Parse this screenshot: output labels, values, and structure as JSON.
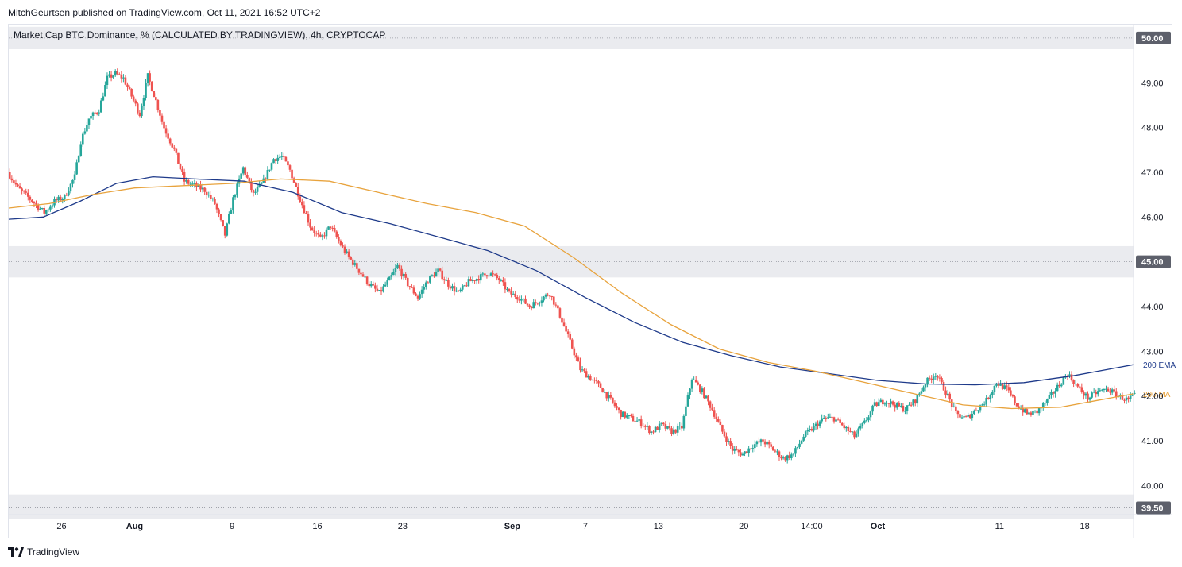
{
  "header": {
    "publisher": "MitchGeurtsen published on TradingView.com, Oct 11, 2021 16:52 UTC+2",
    "symbol_title": "Market Cap BTC Dominance, % (CALCULATED BY TRADINGVIEW), 4h, CRYPTOCAP"
  },
  "footer": {
    "brand": "TradingView",
    "logo_icon": "tradingview-logo-icon"
  },
  "colors": {
    "up": "#26a69a",
    "down": "#ef5350",
    "ema": "#1e3a8a",
    "ma": "#e8a33d",
    "zone": "#eaebef",
    "axis_tag": "#5d606b",
    "grid": "#e0e3eb"
  },
  "chart_data": {
    "type": "candlestick",
    "ylim": [
      39.35,
      50.3
    ],
    "y_ticks": [
      {
        "value": 49.0,
        "label": "49.00"
      },
      {
        "value": 48.0,
        "label": "48.00"
      },
      {
        "value": 47.0,
        "label": "47.00"
      },
      {
        "value": 46.0,
        "label": "46.00"
      },
      {
        "value": 44.0,
        "label": "44.00"
      },
      {
        "value": 43.0,
        "label": "43.00"
      },
      {
        "value": 42.0,
        "label": "42.00"
      },
      {
        "value": 41.0,
        "label": "41.00"
      },
      {
        "value": 40.0,
        "label": "40.00"
      }
    ],
    "y_tags": [
      {
        "value": 50.0,
        "label": "50.00"
      },
      {
        "value": 45.0,
        "label": "45.00"
      },
      {
        "value": 39.5,
        "label": "39.50"
      }
    ],
    "zones": [
      {
        "from": 49.75,
        "to": 50.25
      },
      {
        "from": 44.65,
        "to": 45.35
      },
      {
        "from": 39.25,
        "to": 39.8
      }
    ],
    "x_domain": [
      "2021-07-21T16:00",
      "2021-10-22T00:00"
    ],
    "x_ticks": [
      {
        "t": "2021-07-26",
        "label": "26",
        "bold": false
      },
      {
        "t": "2021-08-01",
        "label": "Aug",
        "bold": true
      },
      {
        "t": "2021-08-09",
        "label": "9",
        "bold": false
      },
      {
        "t": "2021-08-16",
        "label": "16",
        "bold": false
      },
      {
        "t": "2021-08-23",
        "label": "23",
        "bold": false
      },
      {
        "t": "2021-09-01",
        "label": "Sep",
        "bold": true
      },
      {
        "t": "2021-09-07",
        "label": "7",
        "bold": false
      },
      {
        "t": "2021-09-13",
        "label": "13",
        "bold": false
      },
      {
        "t": "2021-09-20",
        "label": "20",
        "bold": false
      },
      {
        "t": "2021-09-25T14:00",
        "label": "14:00",
        "bold": false
      },
      {
        "t": "2021-10-01",
        "label": "Oct",
        "bold": true
      },
      {
        "t": "2021-10-11",
        "label": "11",
        "bold": false
      },
      {
        "t": "2021-10-18",
        "label": "18",
        "bold": false
      }
    ],
    "price_anchors": [
      [
        "2021-07-21T16:00",
        47.0
      ],
      [
        "2021-07-22T12:00",
        46.65
      ],
      [
        "2021-07-23T12:00",
        46.4
      ],
      [
        "2021-07-24T16:00",
        46.1
      ],
      [
        "2021-07-25T12:00",
        46.35
      ],
      [
        "2021-07-26T08:00",
        46.45
      ],
      [
        "2021-07-27T04:00",
        46.9
      ],
      [
        "2021-07-27T16:00",
        47.7
      ],
      [
        "2021-07-28T08:00",
        48.2
      ],
      [
        "2021-07-29T04:00",
        48.4
      ],
      [
        "2021-07-29T20:00",
        49.1
      ],
      [
        "2021-07-30T12:00",
        49.2
      ],
      [
        "2021-07-31T04:00",
        49.1
      ],
      [
        "2021-07-31T20:00",
        48.7
      ],
      [
        "2021-08-01T12:00",
        48.3
      ],
      [
        "2021-08-02T04:00",
        49.15
      ],
      [
        "2021-08-02T20:00",
        48.6
      ],
      [
        "2021-08-03T12:00",
        48.0
      ],
      [
        "2021-08-04T08:00",
        47.5
      ],
      [
        "2021-08-05T04:00",
        46.8
      ],
      [
        "2021-08-06T00:00",
        46.7
      ],
      [
        "2021-08-06T20:00",
        46.6
      ],
      [
        "2021-08-07T16:00",
        46.3
      ],
      [
        "2021-08-08T12:00",
        45.6
      ],
      [
        "2021-08-09T04:00",
        46.4
      ],
      [
        "2021-08-10T00:00",
        47.1
      ],
      [
        "2021-08-10T20:00",
        46.5
      ],
      [
        "2021-08-11T16:00",
        46.8
      ],
      [
        "2021-08-12T12:00",
        47.3
      ],
      [
        "2021-08-13T04:00",
        47.35
      ],
      [
        "2021-08-13T20:00",
        47.05
      ],
      [
        "2021-08-14T16:00",
        46.4
      ],
      [
        "2021-08-15T12:00",
        45.8
      ],
      [
        "2021-08-16T08:00",
        45.5
      ],
      [
        "2021-08-17T04:00",
        45.8
      ],
      [
        "2021-08-17T20:00",
        45.45
      ],
      [
        "2021-08-18T16:00",
        45.1
      ],
      [
        "2021-08-19T12:00",
        44.8
      ],
      [
        "2021-08-20T08:00",
        44.5
      ],
      [
        "2021-08-21T04:00",
        44.3
      ],
      [
        "2021-08-22T00:00",
        44.6
      ],
      [
        "2021-08-22T16:00",
        44.9
      ],
      [
        "2021-08-23T12:00",
        44.5
      ],
      [
        "2021-08-24T08:00",
        44.2
      ],
      [
        "2021-08-25T04:00",
        44.6
      ],
      [
        "2021-08-26T00:00",
        44.8
      ],
      [
        "2021-08-26T20:00",
        44.5
      ],
      [
        "2021-08-27T16:00",
        44.3
      ],
      [
        "2021-08-28T12:00",
        44.55
      ],
      [
        "2021-08-29T08:00",
        44.65
      ],
      [
        "2021-08-30T04:00",
        44.75
      ],
      [
        "2021-08-31T00:00",
        44.6
      ],
      [
        "2021-08-31T20:00",
        44.3
      ],
      [
        "2021-09-01T16:00",
        44.2
      ],
      [
        "2021-09-02T12:00",
        44.0
      ],
      [
        "2021-09-03T08:00",
        44.15
      ],
      [
        "2021-09-04T04:00",
        44.3
      ],
      [
        "2021-09-05T00:00",
        43.8
      ],
      [
        "2021-09-05T20:00",
        43.2
      ],
      [
        "2021-09-06T16:00",
        42.6
      ],
      [
        "2021-09-07T12:00",
        42.4
      ],
      [
        "2021-09-08T08:00",
        42.2
      ],
      [
        "2021-09-09T04:00",
        41.9
      ],
      [
        "2021-09-10T00:00",
        41.6
      ],
      [
        "2021-09-10T20:00",
        41.5
      ],
      [
        "2021-09-11T16:00",
        41.4
      ],
      [
        "2021-09-12T12:00",
        41.2
      ],
      [
        "2021-09-13T08:00",
        41.35
      ],
      [
        "2021-09-14T04:00",
        41.2
      ],
      [
        "2021-09-15T00:00",
        41.3
      ],
      [
        "2021-09-15T20:00",
        42.4
      ],
      [
        "2021-09-16T16:00",
        42.1
      ],
      [
        "2021-09-17T12:00",
        41.7
      ],
      [
        "2021-09-18T08:00",
        41.2
      ],
      [
        "2021-09-19T04:00",
        40.8
      ],
      [
        "2021-09-20T00:00",
        40.7
      ],
      [
        "2021-09-20T20:00",
        40.9
      ],
      [
        "2021-09-21T16:00",
        41.0
      ],
      [
        "2021-09-22T12:00",
        40.8
      ],
      [
        "2021-09-23T08:00",
        40.6
      ],
      [
        "2021-09-24T04:00",
        40.7
      ],
      [
        "2021-09-25T00:00",
        41.1
      ],
      [
        "2021-09-25T20:00",
        41.3
      ],
      [
        "2021-09-26T16:00",
        41.5
      ],
      [
        "2021-09-27T12:00",
        41.5
      ],
      [
        "2021-09-28T08:00",
        41.3
      ],
      [
        "2021-09-29T04:00",
        41.1
      ],
      [
        "2021-09-30T00:00",
        41.4
      ],
      [
        "2021-09-30T20:00",
        41.8
      ],
      [
        "2021-10-01T16:00",
        41.9
      ],
      [
        "2021-10-02T12:00",
        41.8
      ],
      [
        "2021-10-03T08:00",
        41.7
      ],
      [
        "2021-10-04T04:00",
        41.9
      ],
      [
        "2021-10-05T00:00",
        42.3
      ],
      [
        "2021-10-05T20:00",
        42.5
      ],
      [
        "2021-10-06T16:00",
        42.1
      ],
      [
        "2021-10-07T12:00",
        41.6
      ],
      [
        "2021-10-08T08:00",
        41.5
      ],
      [
        "2021-10-09T04:00",
        41.7
      ],
      [
        "2021-10-10T00:00",
        41.9
      ],
      [
        "2021-10-10T20:00",
        42.3
      ],
      [
        "2021-10-11T16:00",
        42.15
      ],
      [
        "2021-10-12T12:00",
        41.8
      ],
      [
        "2021-10-13T08:00",
        41.6
      ],
      [
        "2021-10-14T04:00",
        41.65
      ],
      [
        "2021-10-15T00:00",
        41.9
      ],
      [
        "2021-10-15T20:00",
        42.2
      ],
      [
        "2021-10-16T16:00",
        42.5
      ],
      [
        "2021-10-17T12:00",
        42.2
      ],
      [
        "2021-10-18T08:00",
        41.95
      ],
      [
        "2021-10-19T04:00",
        42.1
      ],
      [
        "2021-10-20T00:00",
        42.15
      ],
      [
        "2021-10-20T20:00",
        42.0
      ],
      [
        "2021-10-21T16:00",
        41.9
      ],
      [
        "2021-10-22T00:00",
        42.0
      ]
    ],
    "indicators": [
      {
        "name": "200 EMA",
        "color": "#1e3a8a",
        "points": [
          [
            "2021-07-21T16:00",
            45.95
          ],
          [
            "2021-07-24T12:00",
            46.0
          ],
          [
            "2021-07-27T12:00",
            46.35
          ],
          [
            "2021-07-30T12:00",
            46.75
          ],
          [
            "2021-08-02T12:00",
            46.9
          ],
          [
            "2021-08-06T00:00",
            46.85
          ],
          [
            "2021-08-10T00:00",
            46.8
          ],
          [
            "2021-08-14T00:00",
            46.55
          ],
          [
            "2021-08-18T00:00",
            46.1
          ],
          [
            "2021-08-22T00:00",
            45.85
          ],
          [
            "2021-08-26T00:00",
            45.55
          ],
          [
            "2021-08-30T00:00",
            45.25
          ],
          [
            "2021-09-03T00:00",
            44.8
          ],
          [
            "2021-09-07T00:00",
            44.2
          ],
          [
            "2021-09-11T00:00",
            43.65
          ],
          [
            "2021-09-15T00:00",
            43.2
          ],
          [
            "2021-09-19T00:00",
            42.9
          ],
          [
            "2021-09-23T00:00",
            42.65
          ],
          [
            "2021-09-27T00:00",
            42.5
          ],
          [
            "2021-10-01T00:00",
            42.35
          ],
          [
            "2021-10-05T00:00",
            42.27
          ],
          [
            "2021-10-09T00:00",
            42.25
          ],
          [
            "2021-10-13T00:00",
            42.3
          ],
          [
            "2021-10-17T00:00",
            42.45
          ],
          [
            "2021-10-20T00:00",
            42.6
          ],
          [
            "2021-10-22T00:00",
            42.7
          ]
        ]
      },
      {
        "name": "200 MA",
        "color": "#e8a33d",
        "points": [
          [
            "2021-07-21T16:00",
            46.2
          ],
          [
            "2021-07-25T00:00",
            46.3
          ],
          [
            "2021-07-28T12:00",
            46.5
          ],
          [
            "2021-08-01T00:00",
            46.65
          ],
          [
            "2021-08-05T00:00",
            46.7
          ],
          [
            "2021-08-09T00:00",
            46.75
          ],
          [
            "2021-08-13T00:00",
            46.85
          ],
          [
            "2021-08-17T00:00",
            46.8
          ],
          [
            "2021-08-21T00:00",
            46.55
          ],
          [
            "2021-08-25T00:00",
            46.3
          ],
          [
            "2021-08-29T00:00",
            46.1
          ],
          [
            "2021-09-02T00:00",
            45.8
          ],
          [
            "2021-09-06T00:00",
            45.1
          ],
          [
            "2021-09-10T00:00",
            44.3
          ],
          [
            "2021-09-14T00:00",
            43.6
          ],
          [
            "2021-09-18T00:00",
            43.05
          ],
          [
            "2021-09-22T00:00",
            42.75
          ],
          [
            "2021-09-26T00:00",
            42.55
          ],
          [
            "2021-09-30T00:00",
            42.3
          ],
          [
            "2021-10-04T00:00",
            42.05
          ],
          [
            "2021-10-08T00:00",
            41.8
          ],
          [
            "2021-10-12T00:00",
            41.72
          ],
          [
            "2021-10-16T00:00",
            41.75
          ],
          [
            "2021-10-19T00:00",
            41.9
          ],
          [
            "2021-10-22T00:00",
            42.05
          ]
        ]
      }
    ]
  }
}
